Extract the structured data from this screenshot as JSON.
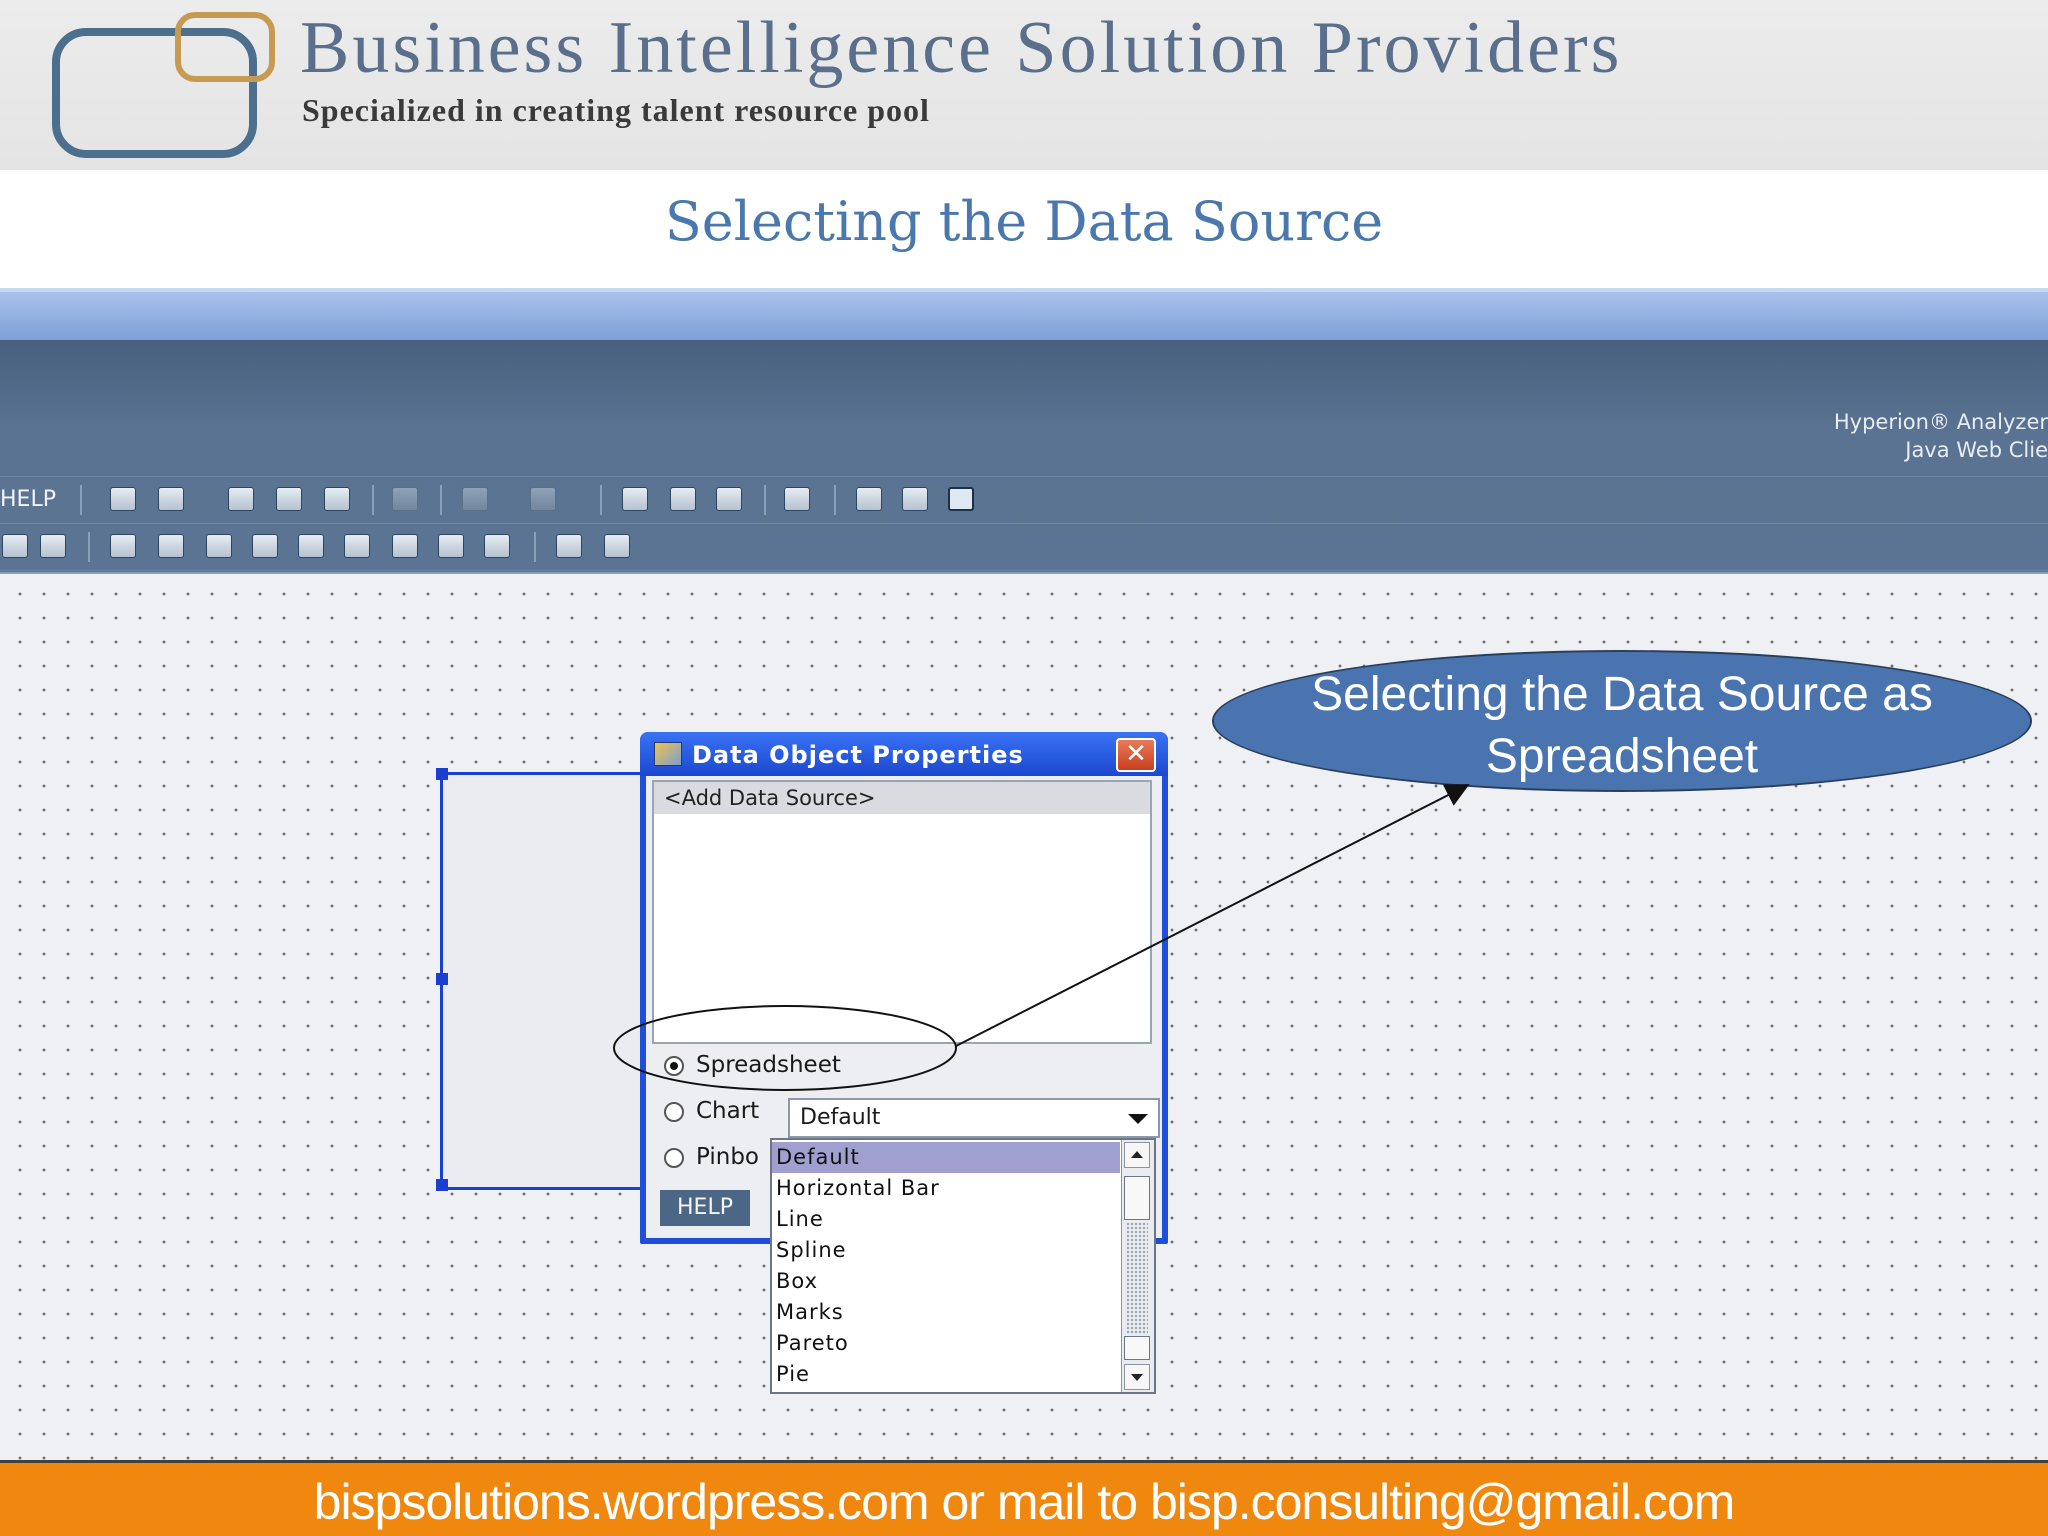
{
  "header": {
    "brand_title": "Business Intelligence Solution Providers",
    "brand_subtitle": "Specialized in creating talent resource pool"
  },
  "slide_title": "Selecting the Data Source",
  "app": {
    "brand_line1": "Hyperion® Analyzer",
    "brand_line2": "Java Web Clie",
    "menu_help": "HELP"
  },
  "dialog": {
    "title": "Data Object Properties",
    "close_glyph": "✕",
    "data_source_item": "<Add Data Source>",
    "radio_spreadsheet": "Spreadsheet",
    "radio_chart": "Chart",
    "radio_pinboard": "Pinbo",
    "chart_type_value": "Default",
    "help_button": "HELP",
    "selected_option": "Spreadsheet"
  },
  "dropdown": {
    "options": [
      "Default",
      "Horizontal Bar",
      "Line",
      "Spline",
      "Box",
      "Marks",
      "Pareto",
      "Pie"
    ],
    "selected": "Default"
  },
  "callout": {
    "line1": "Selecting the Data Source as",
    "line2": "Spreadsheet"
  },
  "footer": {
    "text": "bispsolutions.wordpress.com or mail to bisp.consulting@gmail.com"
  },
  "colors": {
    "title_blue": "#4a78ad",
    "footer_orange": "#f0870f",
    "dialog_blue": "#1f4fd8",
    "callout_fill": "#4a74b0",
    "app_bar": "#5a7392"
  }
}
